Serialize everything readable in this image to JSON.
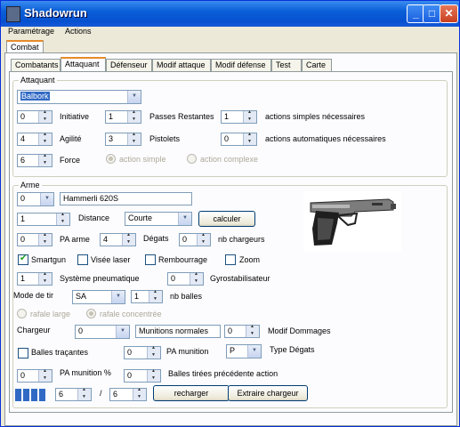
{
  "window": {
    "title": "Shadowrun"
  },
  "menu": [
    "Paramétrage",
    "Actions"
  ],
  "top_tab": "Combat",
  "tabs": [
    "Combatants",
    "Attaquant",
    "Défenseur",
    "Modif attaque",
    "Modif défense",
    "Test",
    "Carte"
  ],
  "attaquant": {
    "group_label": "Attaquant",
    "selected": "Balbork",
    "initiative": {
      "value": "0",
      "label": "Initiative"
    },
    "passes": {
      "value": "1",
      "label": "Passes Restantes"
    },
    "actions_simples": {
      "value": "1",
      "label": "actions simples nécessaires"
    },
    "agilite": {
      "value": "4",
      "label": "Agilité"
    },
    "pistolets": {
      "value": "3",
      "label": "Pistolets"
    },
    "actions_auto": {
      "value": "0",
      "label": "actions automatiques nécessaires"
    },
    "force": {
      "value": "6",
      "label": "Force"
    },
    "radio_simple": "action simple",
    "radio_complexe": "action complexe"
  },
  "arme": {
    "group_label": "Arme",
    "index": "0",
    "name": "Hammerli 620S",
    "distance": {
      "value": "1",
      "label": "Distance",
      "select": "Courte"
    },
    "calculer": "calculer",
    "pa_arme": {
      "value": "0",
      "label": "PA arme"
    },
    "degats": {
      "value": "4",
      "label": "Dégats"
    },
    "chargeurs": {
      "value": "0",
      "label": "nb chargeurs"
    },
    "checks": [
      {
        "label": "Smartgun",
        "checked": true
      },
      {
        "label": "Visée laser",
        "checked": false
      },
      {
        "label": "Rembourrage",
        "checked": false
      },
      {
        "label": "Zoom",
        "checked": false
      }
    ],
    "pneumatique": {
      "value": "1",
      "label": "Système pneumatique"
    },
    "gyro": {
      "value": "0",
      "label": "Gyrostabilisateur"
    },
    "mode_tir": {
      "label": "Mode de tir",
      "value": "SA"
    },
    "nb_balles": {
      "value": "1",
      "label": "nb balles"
    },
    "radio_large": "rafale large",
    "radio_concentree": "rafale concentrée",
    "chargeur": {
      "label": "Chargeur",
      "value": "0",
      "munitions": "Munitions normales"
    },
    "modif_dommages": {
      "value": "0",
      "label": "Modif Dommages"
    },
    "balles_tracantes": "Balles traçantes",
    "tracantes_val": "0",
    "pa_munition": {
      "label": "PA munition",
      "value": "P"
    },
    "type_degats": "Type Dégats",
    "pa_munition_pct": {
      "value": "0",
      "label": "PA munition %"
    },
    "balles_tirees": {
      "value": "0",
      "label": "Balles tirées précédente action"
    },
    "ammo_current": "6",
    "ammo_sep": "/",
    "ammo_max": "6",
    "recharger": "recharger",
    "extraire": "Extraire chargeur"
  }
}
